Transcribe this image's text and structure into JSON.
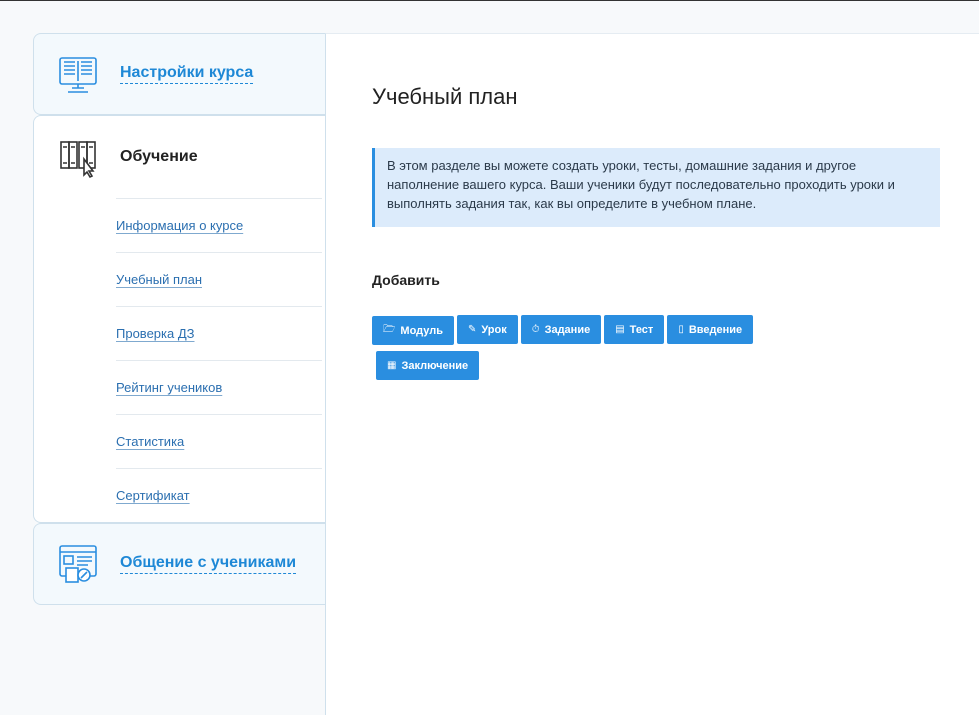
{
  "sidebar": {
    "course_settings": {
      "label": "Настройки курса",
      "icon": "book-monitor-icon"
    },
    "learning": {
      "label": "Обучение",
      "icon": "library-books-icon",
      "items": [
        {
          "label": "Информация о курсе"
        },
        {
          "label": "Учебный план"
        },
        {
          "label": "Проверка ДЗ"
        },
        {
          "label": "Рейтинг учеников"
        },
        {
          "label": "Статистика"
        },
        {
          "label": "Сертификат"
        }
      ]
    },
    "communication": {
      "label": "Общение с учениками",
      "icon": "chat-document-icon"
    }
  },
  "main": {
    "title": "Учебный план",
    "info_text": "В этом разделе вы можете создать уроки, тесты, домашние задания и другое наполнение вашего курса. Ваши ученики будут последовательно проходить уроки и выполнять задания так, как вы определите в учебном плане.",
    "add_label": "Добавить",
    "buttons": [
      {
        "label": "Модуль",
        "icon": "folder-icon"
      },
      {
        "label": "Урок",
        "icon": "edit-icon"
      },
      {
        "label": "Задание",
        "icon": "timer-icon"
      },
      {
        "label": "Тест",
        "icon": "test-icon"
      },
      {
        "label": "Введение",
        "icon": "door-icon"
      },
      {
        "label": "Заключение",
        "icon": "list-icon"
      }
    ]
  },
  "colors": {
    "accent": "#2a8ee0",
    "link": "#1e88d6",
    "info_bg": "#dcebfb"
  }
}
